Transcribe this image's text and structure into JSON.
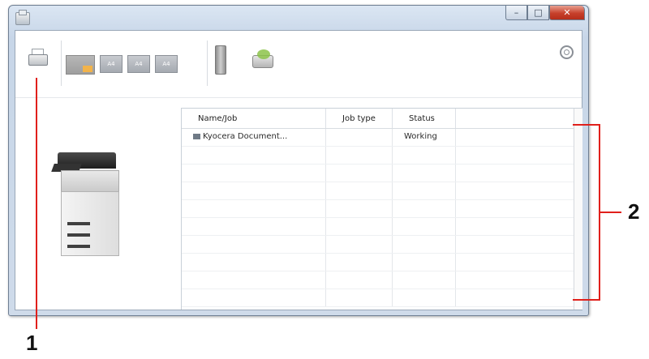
{
  "window": {
    "controls": {
      "minimize": "–",
      "maximize": "□",
      "close": "✕"
    }
  },
  "toolbar": {
    "printer_label": "",
    "tray_label": "",
    "tray_small": [
      "A4",
      "A4",
      "A4"
    ],
    "toner_label": "",
    "scan_label": "",
    "settings_icon": "gear-icon"
  },
  "job_table": {
    "columns": [
      "Name/Job",
      "Job type",
      "Status"
    ],
    "rows": [
      {
        "name": "Kyocera Document...",
        "type": "",
        "status": "Working"
      }
    ],
    "empty_rows": 9
  },
  "callouts": {
    "one": "1",
    "two": "2",
    "color": "#e0201b"
  }
}
